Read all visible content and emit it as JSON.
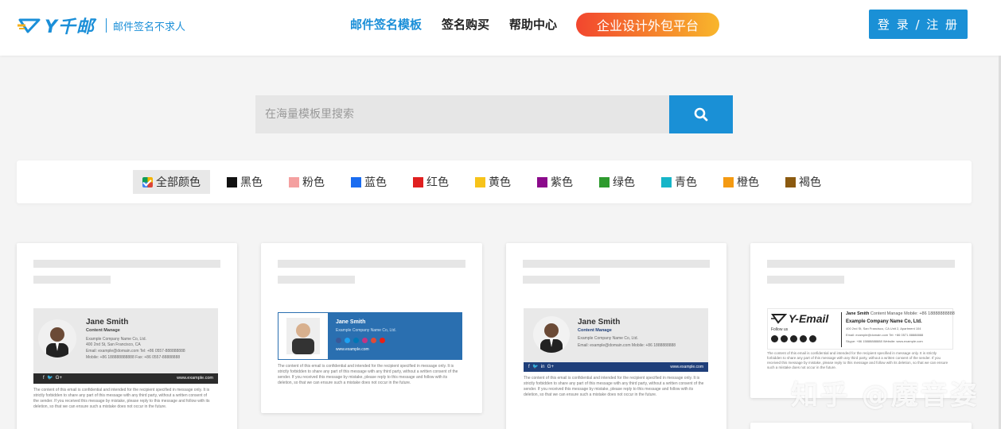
{
  "header": {
    "logo_text": "Y千邮",
    "slogan": "邮件签名不求人",
    "nav": [
      {
        "label": "邮件签名模板",
        "active": true
      },
      {
        "label": "签名购买",
        "active": false
      },
      {
        "label": "帮助中心",
        "active": false
      }
    ],
    "promo": "企业设计外包平台",
    "login": "登 录 / 注 册"
  },
  "search": {
    "placeholder": "在海量模板里搜索"
  },
  "filters": [
    {
      "label": "全部颜色",
      "color": "",
      "active": true
    },
    {
      "label": "黑色",
      "color": "#111111"
    },
    {
      "label": "粉色",
      "color": "#f4a0a0"
    },
    {
      "label": "蓝色",
      "color": "#1a6cf0"
    },
    {
      "label": "红色",
      "color": "#e02020"
    },
    {
      "label": "黄色",
      "color": "#f7c31a"
    },
    {
      "label": "紫色",
      "color": "#8b0a8b"
    },
    {
      "label": "绿色",
      "color": "#2e9a2e"
    },
    {
      "label": "青色",
      "color": "#16b5c8"
    },
    {
      "label": "橙色",
      "color": "#f49a12"
    },
    {
      "label": "褐色",
      "color": "#8b5a10"
    }
  ],
  "cards": [
    {
      "name": "Jane Smith",
      "title": "Content Manage",
      "company": "Example Company Name Co, Ltd.",
      "address": "400 2nd St, San Francisco, CA",
      "phone": "Email: example@domain.com   Tel: +86 0557-888888888",
      "mobile": "Mobile: +86 188888888888    Fax: +86 0557-88888888",
      "url": "www.example.com",
      "disclaimer": "The content of this email is confidential and intended for the recipient specified in message only. It is strictly forbidden to share any part of this message with any third party, without a written consent of the sender. If you received this message by mistake, please reply to this message and follow with its deletion, so that we can ensure such a mistake does not occur in the future."
    },
    {
      "name": "Jane Smith",
      "company": "Example Company Name Co, Ltd.",
      "url": "www.example.com",
      "disclaimer": "The content of this email is confidential and intended for the recipient specified in message only. It is strictly forbidden to share any part of this message with any third party, without a written consent of the sender. If you received this message by mistake, please reply to this message and follow with its deletion, so that we can ensure such a mistake does not occur in the future."
    },
    {
      "name": "Jane Smith",
      "title": "Content Manage",
      "company": "Example Company Name Co, Ltd.",
      "contact": "Email: example@domain.com     Mobile: +86 1888888888",
      "url": "www.example.com",
      "disclaimer": "The content of this email is confidential and intended for the recipient specified in message only. It is strictly forbidden to share any part of this message with any third party, without a written consent of the sender. If you received this message by mistake, please reply to this message and follow with its deletion, so that we can ensure such a mistake does not occur in the future."
    },
    {
      "brand": "Y-Email",
      "follow": "Follow us",
      "name": "Jane Smith",
      "title": "Content Manage   Mobile: +86 18888888888",
      "company": "Example Company Name Co, Ltd.",
      "address": "400 2nd St, San Francisco, CA Unit 2, Apartment 104",
      "email": "Email: example@domain.com     Tel: +86 0571 88888888",
      "wechat": "Skype: +86 15888888888      Website: www.example.com",
      "disclaimer": "The content of this email is confidential and intended for the recipient specified in message only. It is strictly forbidden to share any part of this message with any third party, without a written consent of the sender. If you received this message by mistake, please reply to this message and follow with its deletion, so that we can ensure such a mistake does not occur in the future."
    }
  ],
  "watermark": "知乎 @魔音姿",
  "colors": {
    "brand_blue": "#1a90d6",
    "card3_bar": "#1f3f7a",
    "card2_panel": "#2a6fb0"
  }
}
